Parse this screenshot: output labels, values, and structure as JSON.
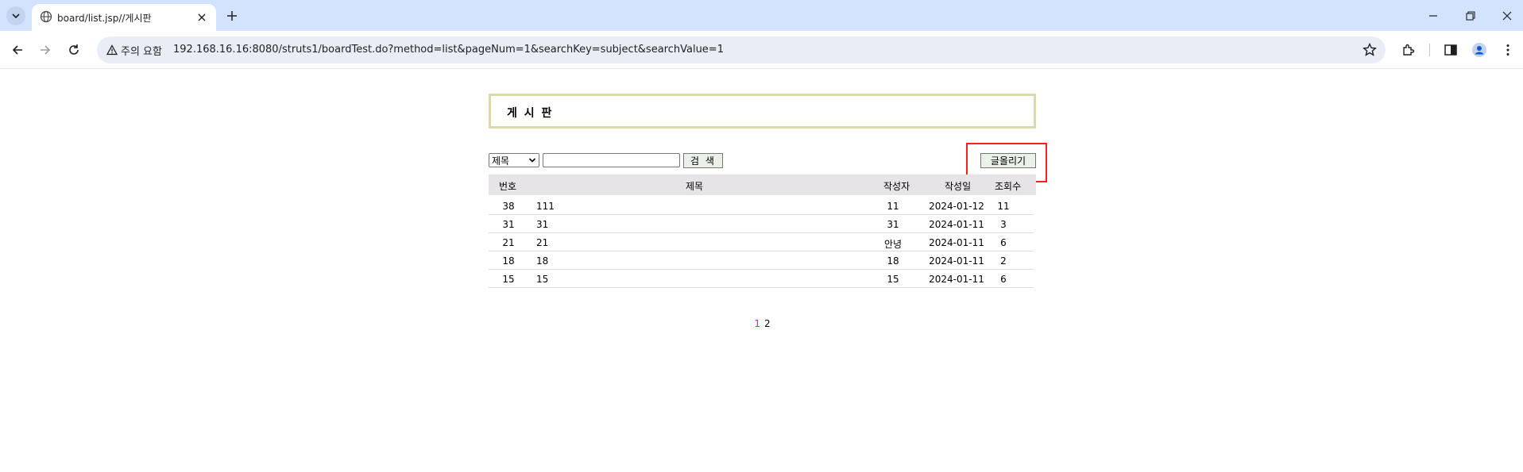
{
  "browser": {
    "tab_title": "board/list.jsp//게시판",
    "security_label": "주의 요함",
    "url": "192.168.16.16:8080/struts1/boardTest.do?method=list&pageNum=1&searchKey=subject&searchValue=1"
  },
  "board": {
    "title": "게 시 판",
    "search": {
      "selected_option": "제목",
      "input_value": "",
      "search_button": "검 색"
    },
    "write_button": "글올리기",
    "columns": {
      "num": "번호",
      "subject": "제목",
      "writer": "작성자",
      "date": "작성일",
      "hits": "조회수"
    },
    "rows": [
      {
        "num": "38",
        "subject": "111",
        "writer": "11",
        "date": "2024-01-12",
        "hits": "11"
      },
      {
        "num": "31",
        "subject": "31",
        "writer": "31",
        "date": "2024-01-11",
        "hits": "3"
      },
      {
        "num": "21",
        "subject": "21",
        "writer": "안녕",
        "date": "2024-01-11",
        "hits": "6"
      },
      {
        "num": "18",
        "subject": "18",
        "writer": "18",
        "date": "2024-01-11",
        "hits": "2"
      },
      {
        "num": "15",
        "subject": "15",
        "writer": "15",
        "date": "2024-01-11",
        "hits": "6"
      }
    ],
    "paging": {
      "current": "1",
      "other": "2"
    }
  },
  "colors": {
    "tabbar_bg": "#d3e3fd",
    "title_border": "#dbdbaa",
    "header_bg": "#e6e4e6",
    "highlight": "#ff1e1e",
    "current_page": "#ff00ff"
  }
}
